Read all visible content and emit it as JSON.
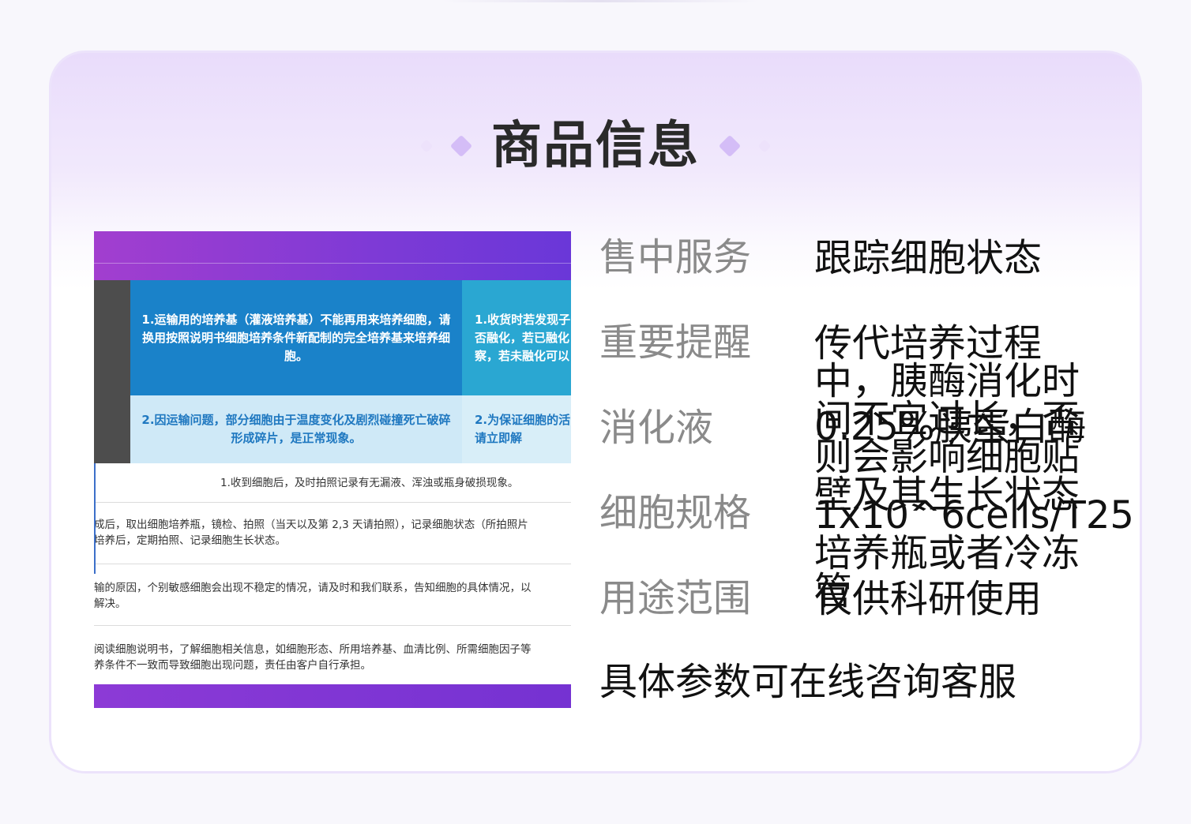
{
  "page": {
    "title": "商品信息"
  },
  "notice": {
    "cells": [
      "1.运输用的培养基（灌液培养基）不能再用来培养细胞，请换用按照说明书细胞培养条件新配制的完全培养基来培养细胞。",
      "1.收货时若发现子否融化，若已融化察，若未融化可以",
      "2.因运输问题，部分细胞由于温度变化及剧烈碰撞死亡破碎形成碎片，是正常现象。",
      "2.为保证细胞的活请立即解"
    ],
    "rows": [
      "1.收到细胞后，及时拍照记录有无漏液、浑浊或瓶身破损现象。",
      [
        "成后，取出细胞培养瓶，镜检、拍照（当天以及第 2,3 天请拍照），记录细胞状态（所拍照片",
        "培养后，定期拍照、记录细胞生长状态。"
      ],
      [
        "输的原因，个别敏感细胞会出现不稳定的情况，请及时和我们联系，告知细胞的具体情况，以",
        "解决。"
      ],
      [
        "阅读细胞说明书，了解细胞相关信息，如细胞形态、所用培养基、血清比例、所需细胞因子等",
        "养条件不一致而导致细胞出现问题，责任由客户自行承担。"
      ]
    ]
  },
  "info": [
    {
      "label": "售中服务",
      "value": "跟踪细胞状态"
    },
    {
      "label": "重要提醒",
      "value": "传代培养过程中，胰酶消化时间不宜过长，否则会影响细胞贴壁及其生长状态"
    },
    {
      "label": "消化液",
      "value": "0.25%胰蛋白酶"
    },
    {
      "label": "细胞规格",
      "value": "1x10^6cells/T25培养瓶或者冷冻管"
    },
    {
      "label": "用途范围",
      "value": "仅供科研使用"
    }
  ],
  "note": "具体参数可在线咨询客服",
  "colors": {
    "accent": "#d4bdf7",
    "notice_banner": "#7d3ad6",
    "notice_blue": "#1a82c9"
  }
}
